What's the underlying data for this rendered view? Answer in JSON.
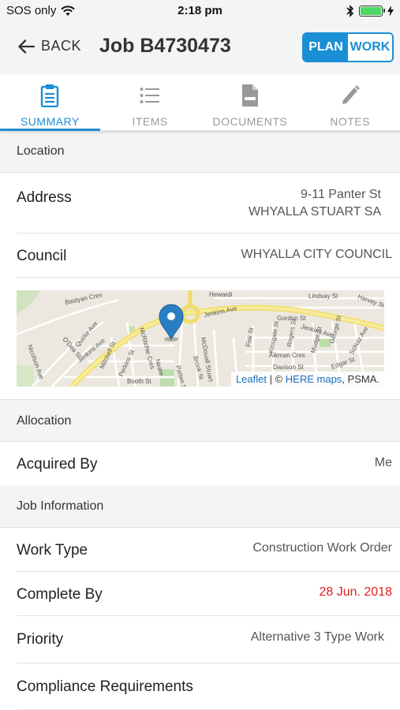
{
  "status_bar": {
    "carrier": "SOS only",
    "time": "2:18 pm",
    "battery_level": 1.0
  },
  "header": {
    "back_label": "BACK",
    "title": "Job B4730473",
    "toggle": {
      "plan": "PLAN",
      "work": "WORK",
      "selected": "PLAN"
    }
  },
  "tabs": [
    {
      "label": "SUMMARY",
      "icon": "clipboard-icon",
      "active": true
    },
    {
      "label": "ITEMS",
      "icon": "list-icon",
      "active": false
    },
    {
      "label": "DOCUMENTS",
      "icon": "document-icon",
      "active": false
    },
    {
      "label": "NOTES",
      "icon": "pencil-icon",
      "active": false
    }
  ],
  "location": {
    "section_title": "Location",
    "address_label": "Address",
    "address_line1": "9-11 Panter St",
    "address_line2": "WHYALLA STUART SA",
    "council_label": "Council",
    "council_value": "WHYALLA CITY COUNCIL"
  },
  "map": {
    "streets": [
      "Jenkins Ave",
      "Jenkins Ave",
      "Jenkins Ave",
      "Bastyan Cres",
      "Lindsay St",
      "Harvey St",
      "Hewardi",
      "Gordon St",
      "Fisk St",
      "Kinsgate St",
      "Rogers St",
      "Aikman Cres",
      "Mudge St",
      "George St",
      "Schulz Ave",
      "Edgar St",
      "Davison St",
      "McDouall Stuart",
      "Brook St",
      "Patten St",
      "Neate",
      "McRitchie Cres",
      "Mitchell St",
      "Perkins St",
      "Booth St",
      "Quirke Ave",
      "O'Dea St",
      "Nicolson Ave"
    ],
    "attribution_leaflet": "Leaflet",
    "attribution_sep": " | © ",
    "attribution_here": "HERE maps",
    "attribution_tail": ", PSMA."
  },
  "allocation": {
    "section_title": "Allocation",
    "acquired_by_label": "Acquired By",
    "acquired_by_value": "Me"
  },
  "job_information": {
    "section_title": "Job Information",
    "work_type_label": "Work Type",
    "work_type_value": "Construction Work Order",
    "complete_by_label": "Complete By",
    "complete_by_value": "28 Jun. 2018",
    "priority_label": "Priority",
    "priority_value": "Alternative 3 Type Work",
    "compliance_label": "Compliance Requirements"
  },
  "colors": {
    "accent": "#1a8fd6",
    "due_date": "#e02020",
    "marker": "#2a7fc4"
  }
}
